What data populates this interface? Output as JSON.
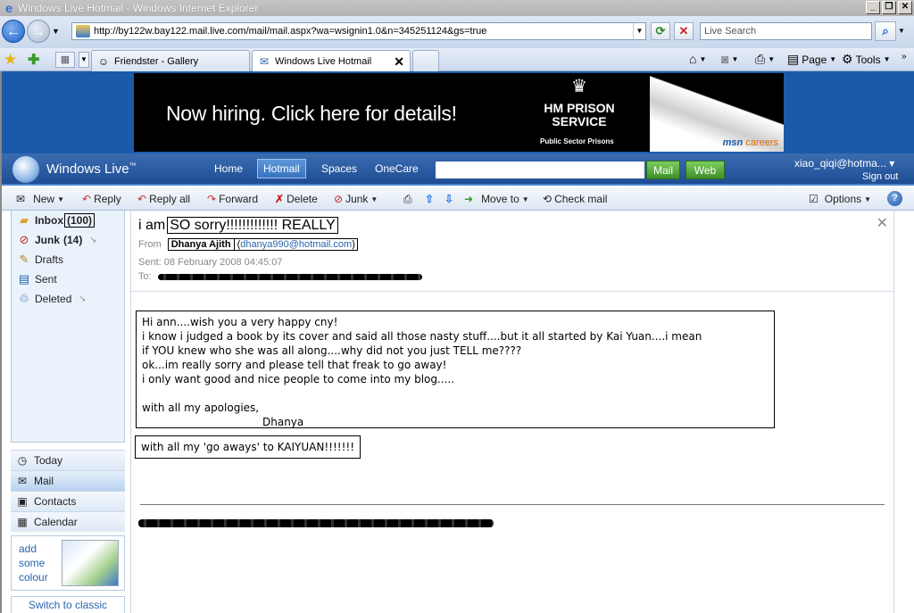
{
  "window": {
    "title": "Windows Live Hotmail - Windows Internet Explorer",
    "minimize": "_",
    "maximize": "❐",
    "close": "✕"
  },
  "browser": {
    "url": "http://by122w.bay122.mail.live.com/mail/mail.aspx?wa=wsignin1.0&n=345251124&gs=true",
    "search_placeholder": "Live Search",
    "tabs": [
      {
        "label": "Friendster - Gallery",
        "active": false
      },
      {
        "label": "Windows Live Hotmail",
        "active": true
      }
    ],
    "commands": {
      "page": "Page",
      "tools": "Tools"
    }
  },
  "ad": {
    "headline": "Now hiring. Click here for details!",
    "brand_line1": "HM PRISON",
    "brand_line2": "SERVICE",
    "tagline": "Public Sector Prisons",
    "network": "msn",
    "network_suffix": "careers"
  },
  "live_header": {
    "brand": "Windows Live",
    "trademark": "™",
    "nav": [
      "Home",
      "Hotmail",
      "Spaces",
      "OneCare"
    ],
    "active_nav": "Hotmail",
    "mail_btn": "Mail",
    "web_btn": "Web",
    "user": "xiao_qiqi@hotma... ▾",
    "sign_out": "Sign out"
  },
  "toolbar": {
    "new": "New",
    "reply": "Reply",
    "reply_all": "Reply all",
    "forward": "Forward",
    "delete": "Delete",
    "junk": "Junk",
    "move_to": "Move to",
    "check_mail": "Check mail",
    "options": "Options",
    "help": "?"
  },
  "folders": {
    "inbox": "Inbox",
    "inbox_count": "(100)",
    "junk": "Junk",
    "junk_count": "(14)",
    "drafts": "Drafts",
    "sent": "Sent",
    "deleted": "Deleted"
  },
  "sections": [
    "Today",
    "Mail",
    "Contacts",
    "Calendar"
  ],
  "active_section": "Mail",
  "promo": {
    "line1": "add",
    "line2": "some",
    "line3": "colour"
  },
  "switch_classic": "Switch to classic",
  "message": {
    "subject_prefix": "i am",
    "subject_boxed": "SO sorry!!!!!!!!!!!!! REALLY",
    "from_label": "From",
    "from_name": "Dhanya Ajith",
    "from_email": "dhanya990@hotmail.com",
    "sent_label": "Sent:",
    "sent_value": "08 February 2008 04:45:07",
    "to_label": "To:",
    "body_lines": [
      "Hi ann....wish you a very happy cny!",
      "i know i judged a book by its cover and said all those nasty stuff....but it all started by Kai Yuan....i mean",
      "if YOU knew who she was all along....why did not you just TELL me????",
      "ok...im really sorry and please tell that freak to go away!",
      "i only want good and nice people to come into my blog.....",
      "",
      "with all my apologies,"
    ],
    "signature": "Dhanya",
    "ps": "with all my 'go aways' to KAIYUAN!!!!!!!"
  }
}
